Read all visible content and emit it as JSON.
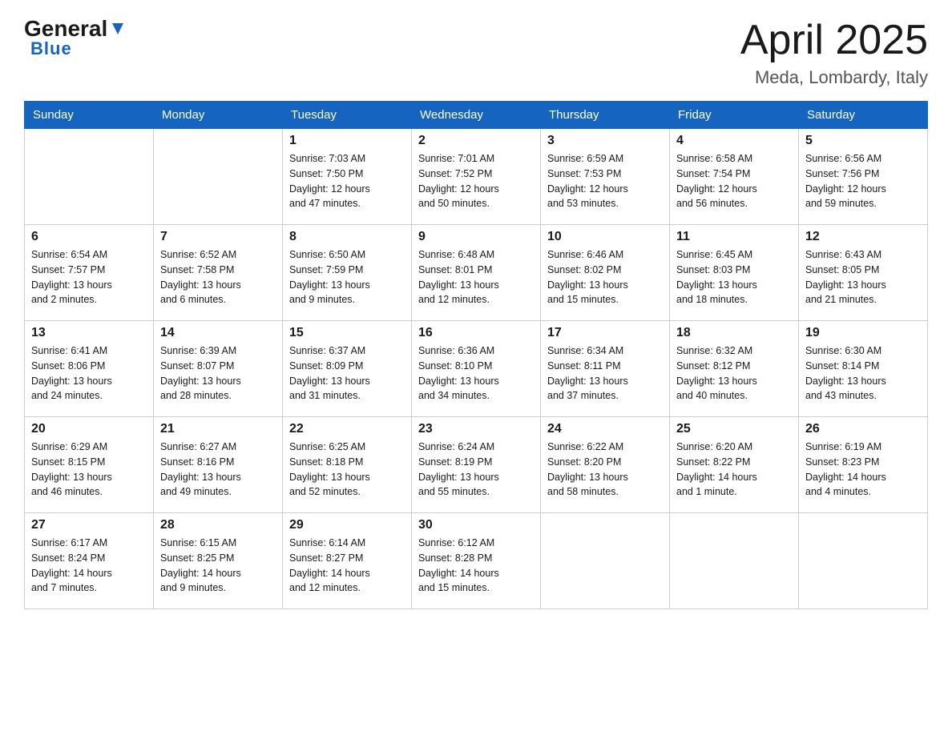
{
  "header": {
    "logo": {
      "general": "General",
      "blue": "Blue"
    },
    "title": "April 2025",
    "location": "Meda, Lombardy, Italy"
  },
  "weekdays": [
    "Sunday",
    "Monday",
    "Tuesday",
    "Wednesday",
    "Thursday",
    "Friday",
    "Saturday"
  ],
  "weeks": [
    [
      {
        "day": "",
        "info": ""
      },
      {
        "day": "",
        "info": ""
      },
      {
        "day": "1",
        "info": "Sunrise: 7:03 AM\nSunset: 7:50 PM\nDaylight: 12 hours\nand 47 minutes."
      },
      {
        "day": "2",
        "info": "Sunrise: 7:01 AM\nSunset: 7:52 PM\nDaylight: 12 hours\nand 50 minutes."
      },
      {
        "day": "3",
        "info": "Sunrise: 6:59 AM\nSunset: 7:53 PM\nDaylight: 12 hours\nand 53 minutes."
      },
      {
        "day": "4",
        "info": "Sunrise: 6:58 AM\nSunset: 7:54 PM\nDaylight: 12 hours\nand 56 minutes."
      },
      {
        "day": "5",
        "info": "Sunrise: 6:56 AM\nSunset: 7:56 PM\nDaylight: 12 hours\nand 59 minutes."
      }
    ],
    [
      {
        "day": "6",
        "info": "Sunrise: 6:54 AM\nSunset: 7:57 PM\nDaylight: 13 hours\nand 2 minutes."
      },
      {
        "day": "7",
        "info": "Sunrise: 6:52 AM\nSunset: 7:58 PM\nDaylight: 13 hours\nand 6 minutes."
      },
      {
        "day": "8",
        "info": "Sunrise: 6:50 AM\nSunset: 7:59 PM\nDaylight: 13 hours\nand 9 minutes."
      },
      {
        "day": "9",
        "info": "Sunrise: 6:48 AM\nSunset: 8:01 PM\nDaylight: 13 hours\nand 12 minutes."
      },
      {
        "day": "10",
        "info": "Sunrise: 6:46 AM\nSunset: 8:02 PM\nDaylight: 13 hours\nand 15 minutes."
      },
      {
        "day": "11",
        "info": "Sunrise: 6:45 AM\nSunset: 8:03 PM\nDaylight: 13 hours\nand 18 minutes."
      },
      {
        "day": "12",
        "info": "Sunrise: 6:43 AM\nSunset: 8:05 PM\nDaylight: 13 hours\nand 21 minutes."
      }
    ],
    [
      {
        "day": "13",
        "info": "Sunrise: 6:41 AM\nSunset: 8:06 PM\nDaylight: 13 hours\nand 24 minutes."
      },
      {
        "day": "14",
        "info": "Sunrise: 6:39 AM\nSunset: 8:07 PM\nDaylight: 13 hours\nand 28 minutes."
      },
      {
        "day": "15",
        "info": "Sunrise: 6:37 AM\nSunset: 8:09 PM\nDaylight: 13 hours\nand 31 minutes."
      },
      {
        "day": "16",
        "info": "Sunrise: 6:36 AM\nSunset: 8:10 PM\nDaylight: 13 hours\nand 34 minutes."
      },
      {
        "day": "17",
        "info": "Sunrise: 6:34 AM\nSunset: 8:11 PM\nDaylight: 13 hours\nand 37 minutes."
      },
      {
        "day": "18",
        "info": "Sunrise: 6:32 AM\nSunset: 8:12 PM\nDaylight: 13 hours\nand 40 minutes."
      },
      {
        "day": "19",
        "info": "Sunrise: 6:30 AM\nSunset: 8:14 PM\nDaylight: 13 hours\nand 43 minutes."
      }
    ],
    [
      {
        "day": "20",
        "info": "Sunrise: 6:29 AM\nSunset: 8:15 PM\nDaylight: 13 hours\nand 46 minutes."
      },
      {
        "day": "21",
        "info": "Sunrise: 6:27 AM\nSunset: 8:16 PM\nDaylight: 13 hours\nand 49 minutes."
      },
      {
        "day": "22",
        "info": "Sunrise: 6:25 AM\nSunset: 8:18 PM\nDaylight: 13 hours\nand 52 minutes."
      },
      {
        "day": "23",
        "info": "Sunrise: 6:24 AM\nSunset: 8:19 PM\nDaylight: 13 hours\nand 55 minutes."
      },
      {
        "day": "24",
        "info": "Sunrise: 6:22 AM\nSunset: 8:20 PM\nDaylight: 13 hours\nand 58 minutes."
      },
      {
        "day": "25",
        "info": "Sunrise: 6:20 AM\nSunset: 8:22 PM\nDaylight: 14 hours\nand 1 minute."
      },
      {
        "day": "26",
        "info": "Sunrise: 6:19 AM\nSunset: 8:23 PM\nDaylight: 14 hours\nand 4 minutes."
      }
    ],
    [
      {
        "day": "27",
        "info": "Sunrise: 6:17 AM\nSunset: 8:24 PM\nDaylight: 14 hours\nand 7 minutes."
      },
      {
        "day": "28",
        "info": "Sunrise: 6:15 AM\nSunset: 8:25 PM\nDaylight: 14 hours\nand 9 minutes."
      },
      {
        "day": "29",
        "info": "Sunrise: 6:14 AM\nSunset: 8:27 PM\nDaylight: 14 hours\nand 12 minutes."
      },
      {
        "day": "30",
        "info": "Sunrise: 6:12 AM\nSunset: 8:28 PM\nDaylight: 14 hours\nand 15 minutes."
      },
      {
        "day": "",
        "info": ""
      },
      {
        "day": "",
        "info": ""
      },
      {
        "day": "",
        "info": ""
      }
    ]
  ]
}
